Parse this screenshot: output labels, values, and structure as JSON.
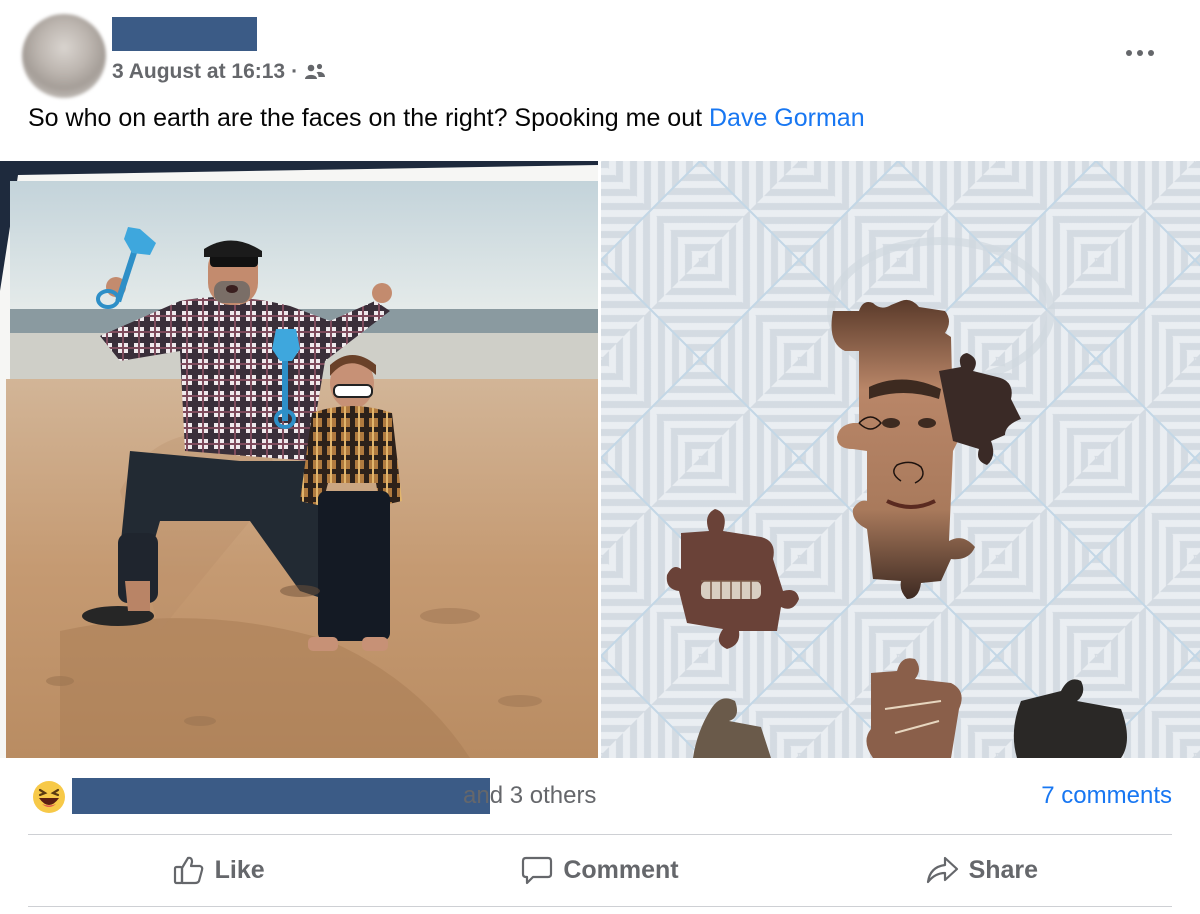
{
  "post": {
    "timestamp": "3 August at 16:13",
    "separator": "·",
    "audience_icon": "friends-icon",
    "menu_icon": "more-options-icon",
    "text": "So who on earth are the faces on the right? Spooking me out ",
    "mention": "Dave Gorman"
  },
  "photos": [
    {
      "description_icon": "beach-photo"
    },
    {
      "description_icon": "jigsaw-photo"
    }
  ],
  "reactions": {
    "icon": "haha-reaction-icon",
    "others": "and 3 others",
    "comments": "7 comments"
  },
  "actions": {
    "like": "Like",
    "comment": "Comment",
    "share": "Share"
  },
  "colors": {
    "link": "#1877f2",
    "secondary_text": "#65676b",
    "redaction": "#3b5b86"
  }
}
